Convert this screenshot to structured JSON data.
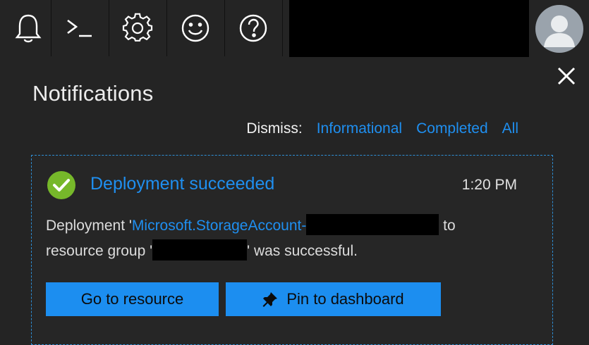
{
  "toolbar": {
    "icons": [
      "bell-icon",
      "terminal-icon",
      "gear-icon",
      "smiley-icon",
      "help-icon"
    ]
  },
  "panel": {
    "title": "Notifications",
    "dismiss_label": "Dismiss:",
    "dismiss_links": [
      "Informational",
      "Completed",
      "All"
    ]
  },
  "notification": {
    "title": "Deployment succeeded",
    "time": "1:20 PM",
    "msg_prefix": "Deployment '",
    "deployment_name": "Microsoft.StorageAccount-",
    "msg_mid": " to",
    "msg_line2_prefix": "resource group '",
    "msg_suffix": "' was successful.",
    "primary_button": "Go to resource",
    "secondary_button": "Pin to dashboard"
  },
  "colors": {
    "background": "#242424",
    "accent": "#1f8ff0",
    "success": "#76b82a",
    "button": "#1c8ef0"
  }
}
